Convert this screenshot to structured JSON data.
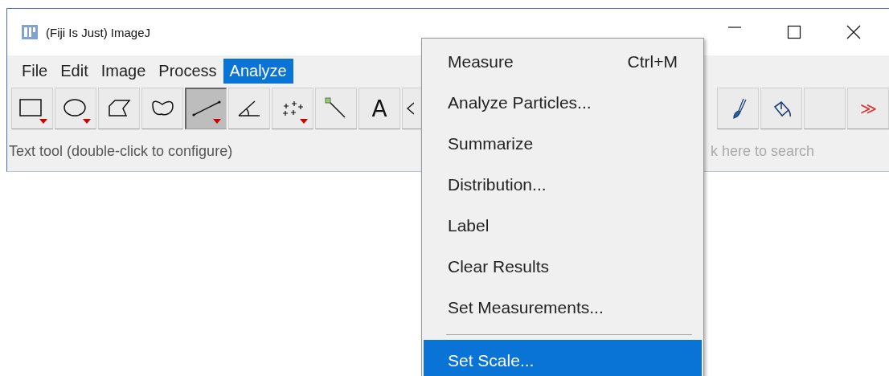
{
  "window": {
    "title": "(Fiji Is Just) ImageJ"
  },
  "menu_bar": [
    {
      "label": "File",
      "selected": false
    },
    {
      "label": "Edit",
      "selected": false
    },
    {
      "label": "Image",
      "selected": false
    },
    {
      "label": "Process",
      "selected": false
    },
    {
      "label": "Analyze",
      "selected": true
    }
  ],
  "tools": [
    {
      "kind": "rectangle",
      "selected": false,
      "has_menu": true
    },
    {
      "kind": "oval",
      "selected": false,
      "has_menu": true
    },
    {
      "kind": "polygon",
      "selected": false,
      "has_menu": false
    },
    {
      "kind": "freehand",
      "selected": false,
      "has_menu": false
    },
    {
      "kind": "line",
      "selected": true,
      "has_menu": true
    },
    {
      "kind": "angle",
      "selected": false,
      "has_menu": false
    },
    {
      "kind": "points",
      "selected": false,
      "has_menu": true
    },
    {
      "kind": "wand",
      "selected": false,
      "has_menu": false
    },
    {
      "kind": "text",
      "label": "A",
      "selected": false,
      "has_menu": false
    }
  ],
  "right_tools": [
    {
      "kind": "brush",
      "selected": false
    },
    {
      "kind": "bucket",
      "selected": false
    },
    {
      "kind": "blank",
      "selected": false
    },
    {
      "kind": "more",
      "label": "≫",
      "selected": false
    }
  ],
  "status_bar": {
    "text": "Text tool (double-click to configure)",
    "search_placeholder": "k here to search"
  },
  "menu": [
    {
      "kind": "item",
      "label": "Measure",
      "shortcut": "Ctrl+M",
      "selected": false
    },
    {
      "kind": "item",
      "label": "Analyze Particles...",
      "selected": false
    },
    {
      "kind": "item",
      "label": "Summarize",
      "selected": false
    },
    {
      "kind": "item",
      "label": "Distribution...",
      "selected": false
    },
    {
      "kind": "item",
      "label": "Label",
      "selected": false
    },
    {
      "kind": "item",
      "label": "Clear Results",
      "selected": false
    },
    {
      "kind": "item",
      "label": "Set Measurements...",
      "selected": false
    },
    {
      "kind": "separator"
    },
    {
      "kind": "item",
      "label": "Set Scale...",
      "selected": true
    }
  ]
}
